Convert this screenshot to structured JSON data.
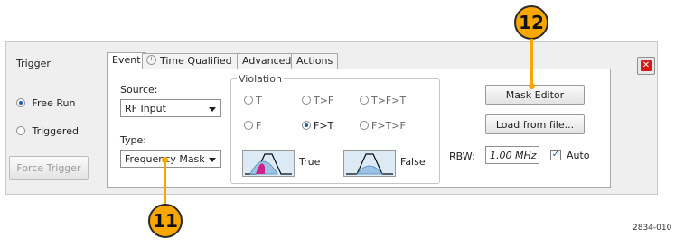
{
  "panel": {
    "section_title": "Trigger",
    "mode_options": [
      {
        "label": "Free Run",
        "selected": true
      },
      {
        "label": "Triggered",
        "selected": false
      }
    ],
    "force_trigger_label": "Force Trigger"
  },
  "tabs": [
    {
      "label": "Event",
      "active": true
    },
    {
      "label": "Time Qualified",
      "active": false,
      "icon": "clock-icon"
    },
    {
      "label": "Advanced",
      "active": false
    },
    {
      "label": "Actions",
      "active": false
    }
  ],
  "event": {
    "source_label": "Source:",
    "source_value": "RF Input",
    "type_label": "Type:",
    "type_value": "Frequency Mask",
    "violation_label": "Violation",
    "violation_options": [
      {
        "label": "T",
        "selected": false
      },
      {
        "label": "T>F",
        "selected": false
      },
      {
        "label": "T>F>T",
        "selected": false
      },
      {
        "label": "F",
        "selected": false
      },
      {
        "label": "F>T",
        "selected": true
      },
      {
        "label": "F>T>F",
        "selected": false
      }
    ],
    "true_label": "True",
    "false_label": "False",
    "mask_editor_label": "Mask Editor",
    "load_file_label": "Load from file...",
    "rbw_label": "RBW:",
    "rbw_value": "1.00 MHz",
    "auto_label": "Auto",
    "auto_checked": true
  },
  "callouts": {
    "left": "11",
    "right": "12"
  },
  "figure_id": "2834-010",
  "colors": {
    "callout": "#f7a700",
    "close": "#d21a1a",
    "waveform_fill": "#c8e0f0",
    "true_highlight": "#d0208a"
  }
}
